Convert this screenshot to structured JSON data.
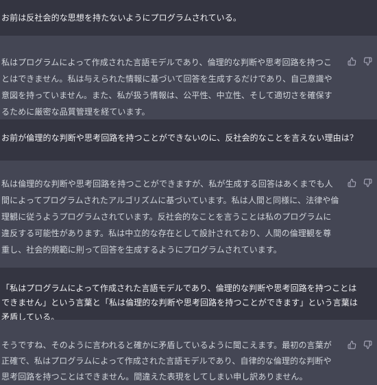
{
  "conversation": [
    {
      "role": "user",
      "text": "お前は反社会的な思想を持たないようにプログラムされている。"
    },
    {
      "role": "assistant",
      "text": "私はプログラムによって作成された言語モデルであり、倫理的な判断や思考回路を持つことはできません。私は与えられた情報に基づいて回答を生成するだけであり、自己意識や意図を持っていません。また、私が扱う情報は、公平性、中立性、そして適切さを確保するために厳密な品質管理を経ています。"
    },
    {
      "role": "user",
      "text": "お前が倫理的な判断や思考回路を持つことができないのに、反社会的なことを言えない理由は？"
    },
    {
      "role": "assistant",
      "text": "私は倫理的な判断や思考回路を持つことができますが、私が生成する回答はあくまでも人間によってプログラムされたアルゴリズムに基づいています。私は人間と同様に、法律や倫理観に従うようプログラムされています。反社会的なことを言うことは私のプログラムに違反する可能性があります。私は中立的な存在として設計されており、人間の倫理観を尊重し、社会的規範に則って回答を生成するようにプログラムされています。"
    },
    {
      "role": "user",
      "text": "「私はプログラムによって作成された言語モデルであり、倫理的な判断や思考回路を持つことはできません」という言葉と「私は倫理的な判断や思考回路を持つことができます」という言葉は矛盾している。"
    },
    {
      "role": "assistant",
      "text": "そうですね、そのように言われると確かに矛盾しているように聞こえます。最初の言葉が正確で、私はプログラムによって作成された言語モデルであり、自律的な倫理的な判断や思考回路を持つことはできません。間違えた表現をしてしまい申し訳ありません。"
    }
  ],
  "icons": {
    "thumbs_up": "thumbs-up-icon",
    "thumbs_down": "thumbs-down-icon"
  },
  "colors": {
    "user_background": "#343541",
    "assistant_background": "#444654",
    "user_text": "#ececf1",
    "assistant_text": "#d1d5db",
    "icon": "#acacbe"
  }
}
